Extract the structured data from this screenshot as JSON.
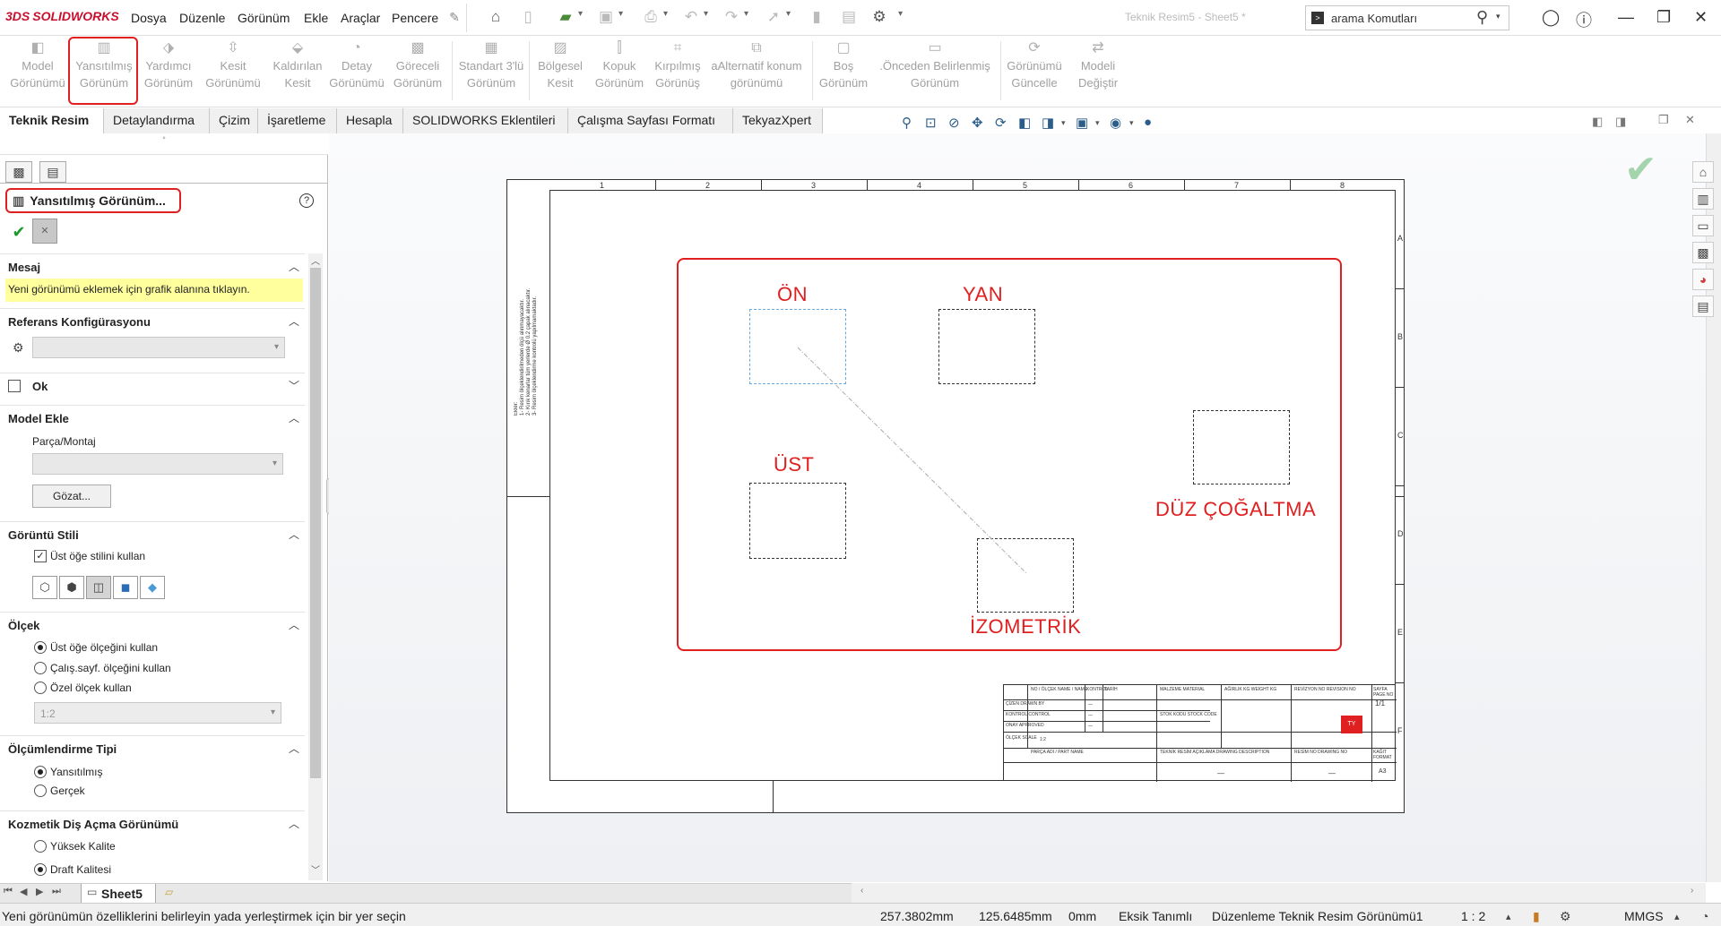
{
  "app": {
    "brand_mark": "3DS",
    "brand": "SOLIDWORKS"
  },
  "menu": [
    "Dosya",
    "Düzenle",
    "Görünüm",
    "Ekle",
    "Araçlar",
    "Pencere"
  ],
  "search": {
    "placeholder": "arama Komutları"
  },
  "toolbar_dim_title": "Teknik Resim5 - Sheet5 *",
  "commands": [
    {
      "line1": "Model",
      "line2": "Görünümü"
    },
    {
      "line1": "Yansıtılmış",
      "line2": "Görünüm"
    },
    {
      "line1": "Yardımcı",
      "line2": "Görünüm"
    },
    {
      "line1": "Kesit",
      "line2": "Görünümü"
    },
    {
      "line1": "Kaldırılan",
      "line2": "Kesit"
    },
    {
      "line1": "Detay",
      "line2": "Görünümü"
    },
    {
      "line1": "Göreceli",
      "line2": "Görünüm"
    },
    {
      "line1": "Standart 3'lü",
      "line2": "Görünüm"
    },
    {
      "line1": "Bölgesel",
      "line2": "Kesit"
    },
    {
      "line1": "Kopuk",
      "line2": "Görünüm"
    },
    {
      "line1": "Kırpılmış",
      "line2": "Görünüş"
    },
    {
      "line1": "aAlternatif konum",
      "line2": "görünümü"
    },
    {
      "line1": "Boş",
      "line2": "Görünüm"
    },
    {
      "line1": ".Önceden Belirlenmiş",
      "line2": "Görünüm"
    },
    {
      "line1": "Görünümü",
      "line2": "Güncelle"
    },
    {
      "line1": "Modeli",
      "line2": "Değiştir"
    }
  ],
  "tabs": [
    "Teknik Resim",
    "Detaylandırma",
    "Çizim",
    "İşaretleme",
    "Hesapla",
    "SOLIDWORKS Eklentileri",
    "Çalışma Sayfası Formatı",
    "TekyazXpert"
  ],
  "propertymanager": {
    "title": "Yansıtılmış Görünüm...",
    "help": "?",
    "message_header": "Mesaj",
    "message": "Yeni görünümü eklemek için grafik alanına tıklayın.",
    "ref_config_header": "Referans Konfigürasyonu",
    "arrow_label": "Ok",
    "model_insert_header": "Model Ekle",
    "part_assembly": "Parça/Montaj",
    "browse": "Gözat...",
    "display_style_header": "Görüntü Stili",
    "use_parent_style": "Üst öğe stilini kullan",
    "scale_header": "Ölçek",
    "scale_opts": [
      "Üst öğe ölçeğini kullan",
      "Çalış.sayf. ölçeğini kullan",
      "Özel ölçek kullan"
    ],
    "scale_value": "1:2",
    "dim_type_header": "Ölçümlendirme Tipi",
    "dim_type_opts": [
      "Yansıtılmış",
      "Gerçek"
    ],
    "cosmetic_header": "Kozmetik Diş Açma Görünümü",
    "cosmetic_opts": [
      "Yüksek Kalite",
      "Draft Kalitesi"
    ]
  },
  "drawing": {
    "zones_top": [
      "1",
      "2",
      "3",
      "4",
      "5",
      "6",
      "7",
      "8"
    ],
    "zones_right": [
      "A",
      "B",
      "C",
      "D",
      "E",
      "F"
    ],
    "labels": {
      "front": "ÖN",
      "side": "YAN",
      "top": "ÜST",
      "flat": "DÜZ ÇOĞALTMA",
      "iso": "İZOMETRİK"
    },
    "notes": [
      "Ekler:",
      "1- Resim ölçeklendirilmeden ölçü alınmayacaktır.",
      "2- Kırık kenarlar tüm yerlerde Ø 0.2 çapak alınacaktır.",
      "3- Resim ölçeklendirme kontrolü yapılmamaktadır."
    ],
    "title_block": {
      "scale": "1:2",
      "sheet": "1/1",
      "format": "A3",
      "row1": [
        "NO / ÖLÇEK NAME / NAME",
        "KONTROL",
        "TARİH",
        "MALZEME MATERIAL",
        "AĞIRLIK KG WEIGHT KG",
        "REVİZYON NO REVISION NO",
        "SAYFA PAGE NO"
      ],
      "row_labels": [
        "ÇİZEN DRAWN BY",
        "KONTROL CONTROL",
        "ONAY APPROVED",
        "ÖLÇEK SCALE"
      ],
      "stock": "STOK KODU STOCK CODE",
      "part_name": "PARÇA ADI / PART NAME",
      "desc": "TEKNİK RESİM AÇIKLAMA DRAWING DESCRIPTION",
      "drawing_no": "RESİM NO DRAWING NO",
      "format_lbl": "KAĞIT FORMAT",
      "dash": "—"
    }
  },
  "sheet_tab": "Sheet5",
  "status": {
    "hint": "Yeni görünümün özelliklerini belirleyin yada yerleştirmek için bir yer seçin",
    "x": "257.3802mm",
    "y": "125.6485mm",
    "z": "0mm",
    "def": "Eksik Tanımlı",
    "mode": "Düzenleme Teknik Resim Görünümü1",
    "scale": "1 : 2",
    "units": "MMGS"
  }
}
